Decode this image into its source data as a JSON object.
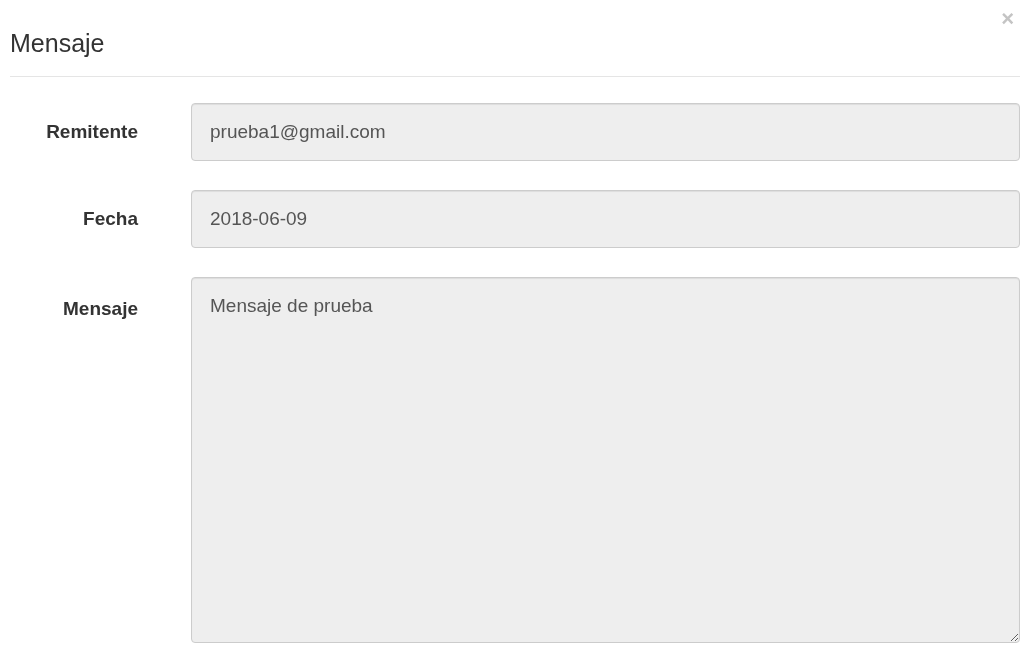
{
  "modal": {
    "title": "Mensaje",
    "close": "×"
  },
  "fields": [
    {
      "kind": "input",
      "label": "Remitente",
      "value": "prueba1@gmail.com",
      "disabled": true
    },
    {
      "kind": "input",
      "label": "Fecha",
      "value": "2018-06-09",
      "disabled": true
    },
    {
      "kind": "textarea",
      "label": "Mensaje",
      "value": "Mensaje de prueba",
      "disabled": true
    }
  ]
}
